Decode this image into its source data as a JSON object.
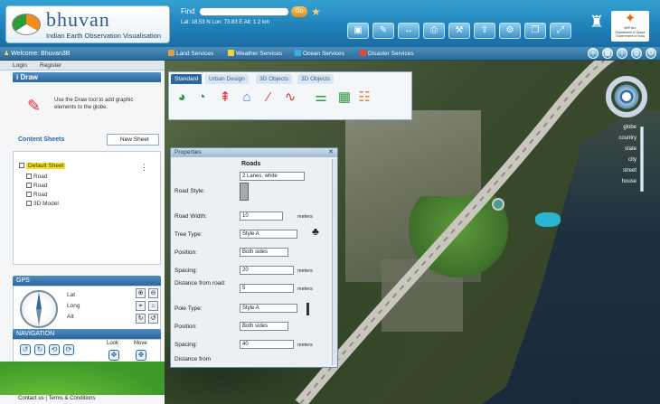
{
  "header": {
    "logo_title": "bhuvan",
    "logo_subtitle": "Indian Earth Observation Visualisation",
    "find_label": "Find",
    "go_label": "Go",
    "coords": "Lat: 18.53 N  Lon: 73.83 E  Alt: 1.2 km",
    "toolbar_icons": [
      "layers-icon",
      "draw-icon",
      "measure-icon",
      "print-icon",
      "tools-icon",
      "share-icon",
      "settings-icon",
      "window-icon"
    ],
    "isro_label": "इसरो isro",
    "isro_sub": "Department of Space Government of India"
  },
  "menubar": {
    "welcome": "Welcome: Bhuvan3B",
    "items": [
      "Land Services",
      "Weather Services",
      "Ocean Services",
      "Disaster Services"
    ]
  },
  "left": {
    "login": "Login",
    "register": "Register",
    "idraw_title": "i Draw",
    "draw_hint": "Use the Draw tool to add graphic elements to the globe.",
    "content_sheets": "Content Sheets",
    "new_sheet": "New Sheet",
    "tree": {
      "root": "Default Sheet",
      "children": [
        "Road",
        "Road",
        "Road",
        "3D Model"
      ]
    },
    "gps_title": "GPS",
    "lat": "Lat",
    "long": "Long",
    "alt": "Alt",
    "navigation_title": "NAVIGATION",
    "look": "Look",
    "move": "Move",
    "footer": "Contact us | Terms & Conditions"
  },
  "drawbar": {
    "tabs": [
      "Standard",
      "Urban Design",
      "3D Objects",
      "3D Objects"
    ]
  },
  "props": {
    "title": "Properties",
    "section": "Roads",
    "road_style_label": "Road Style:",
    "road_style_value": "2 Lanes, white",
    "road_width_label": "Road Width:",
    "road_width_value": "10",
    "tree_type_label": "Tree Type:",
    "tree_type_value": "Style A",
    "position_label": "Position:",
    "position_value": "Both sides",
    "spacing_label": "Spacing:",
    "spacing_value": "20",
    "distance_label": "Distance from road:",
    "distance_value": "5",
    "pole_type_label": "Pole Type:",
    "pole_type_value": "Style A",
    "position2_value": "Both sides",
    "spacing2_value": "40",
    "distance2_label": "Distance from",
    "meters": "meters"
  },
  "nav_levels": [
    "globe",
    "country",
    "state",
    "city",
    "street",
    "house"
  ],
  "colors": {
    "header_blue": "#2380bc",
    "selection_yellow": "#f6e21a",
    "brand_green": "#5fb53a"
  }
}
